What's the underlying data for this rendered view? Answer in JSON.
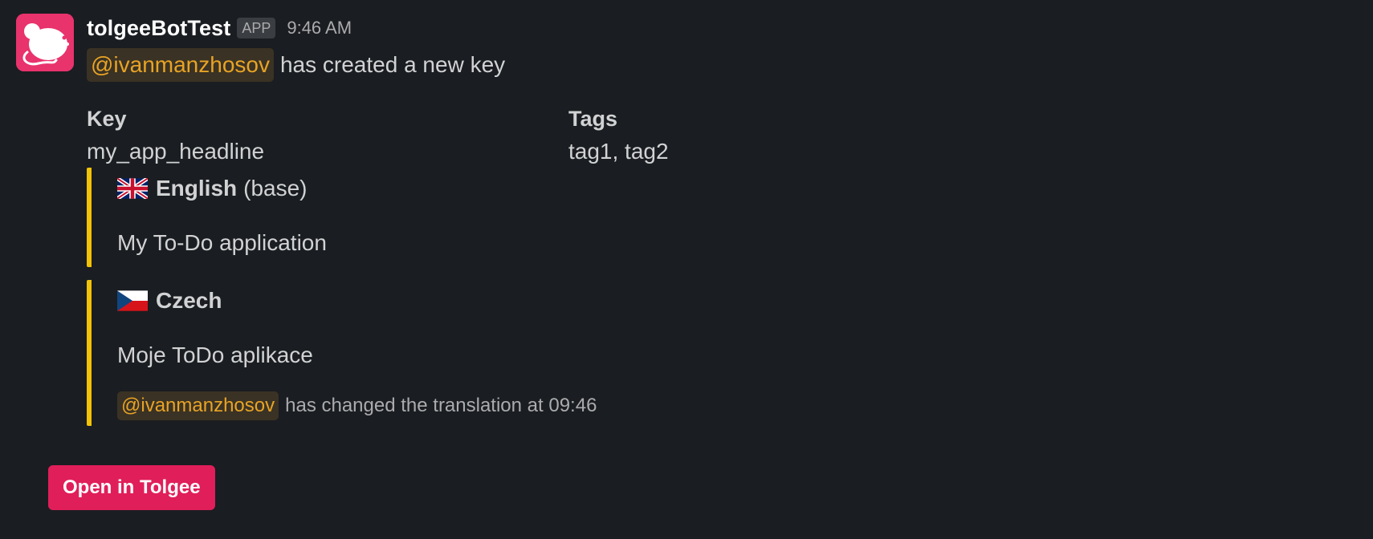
{
  "message": {
    "bot_name": "tolgeeBotTest",
    "app_badge": "APP",
    "timestamp": "9:46 AM",
    "mention": "@ivanmanzhosov",
    "text": "has created a new key"
  },
  "fields": {
    "key": {
      "title": "Key",
      "value": "my_app_headline"
    },
    "tags": {
      "title": "Tags",
      "value": "tag1, tag2"
    }
  },
  "translations": [
    {
      "flag_icon": "uk-flag-icon",
      "language": "English",
      "suffix": "(base)",
      "text": "My To-Do application"
    },
    {
      "flag_icon": "czech-flag-icon",
      "language": "Czech",
      "text": "Moje ToDo aplikace",
      "context_mention": "@ivanmanzhosov",
      "context_text": "has changed the translation at 09:46"
    }
  ],
  "action": {
    "label": "Open in Tolgee"
  },
  "colors": {
    "background": "#1a1d21",
    "avatar": "#e8336d",
    "attachment_bar": "#f2c307",
    "mention_text": "#e8a325",
    "button": "#e01e5a"
  }
}
